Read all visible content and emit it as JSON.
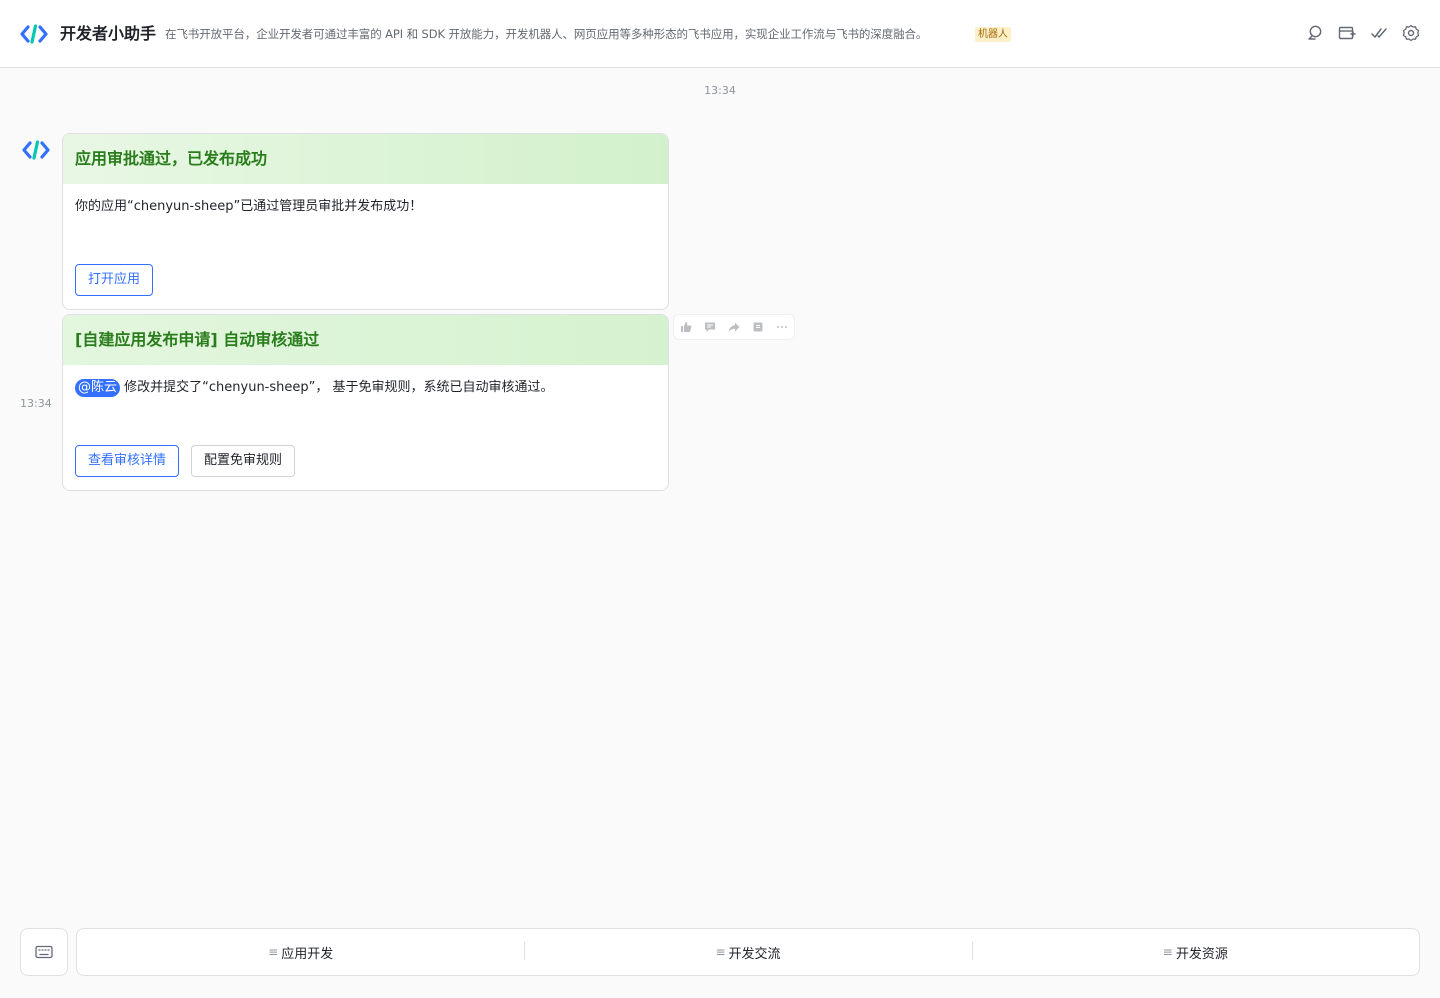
{
  "header": {
    "title": "开发者小助手",
    "description": "在飞书开放平台，企业开发者可通过丰富的 API 和 SDK 开放能力，开发机器人、网页应用等多种形态的飞书应用，实现企业工作流与飞书的深度融合。",
    "badge": "机器人",
    "icons": [
      "search-icon",
      "add-tab-icon",
      "checklist-icon",
      "settings-icon"
    ]
  },
  "timestamp": "13:34",
  "messages": [
    {
      "title": "应用审批通过，已发布成功",
      "body": "你的应用“chenyun-sheep”已通过管理员审批并发布成功！",
      "buttons": [
        "打开应用"
      ]
    },
    {
      "title": "[自建应用发布申请] 自动审核通过",
      "mention": "@陈云",
      "body": "修改并提交了“chenyun-sheep”， 基于免审规则，系统已自动审核通过。",
      "buttons": [
        "查看审核详情",
        "配置免审规则"
      ],
      "time": "13:34"
    }
  ],
  "toolbar": [
    "thumbs-up-icon",
    "comment-icon",
    "forward-icon",
    "delete-icon",
    "more-icon"
  ],
  "bottom_menu": {
    "icon": "≡",
    "items": [
      "应用开发",
      "开发交流",
      "开发资源"
    ]
  },
  "colors": {
    "accent": "#3370ff",
    "card_title": "#2a7d1d",
    "card_header_bg": "#d5f2cf"
  }
}
